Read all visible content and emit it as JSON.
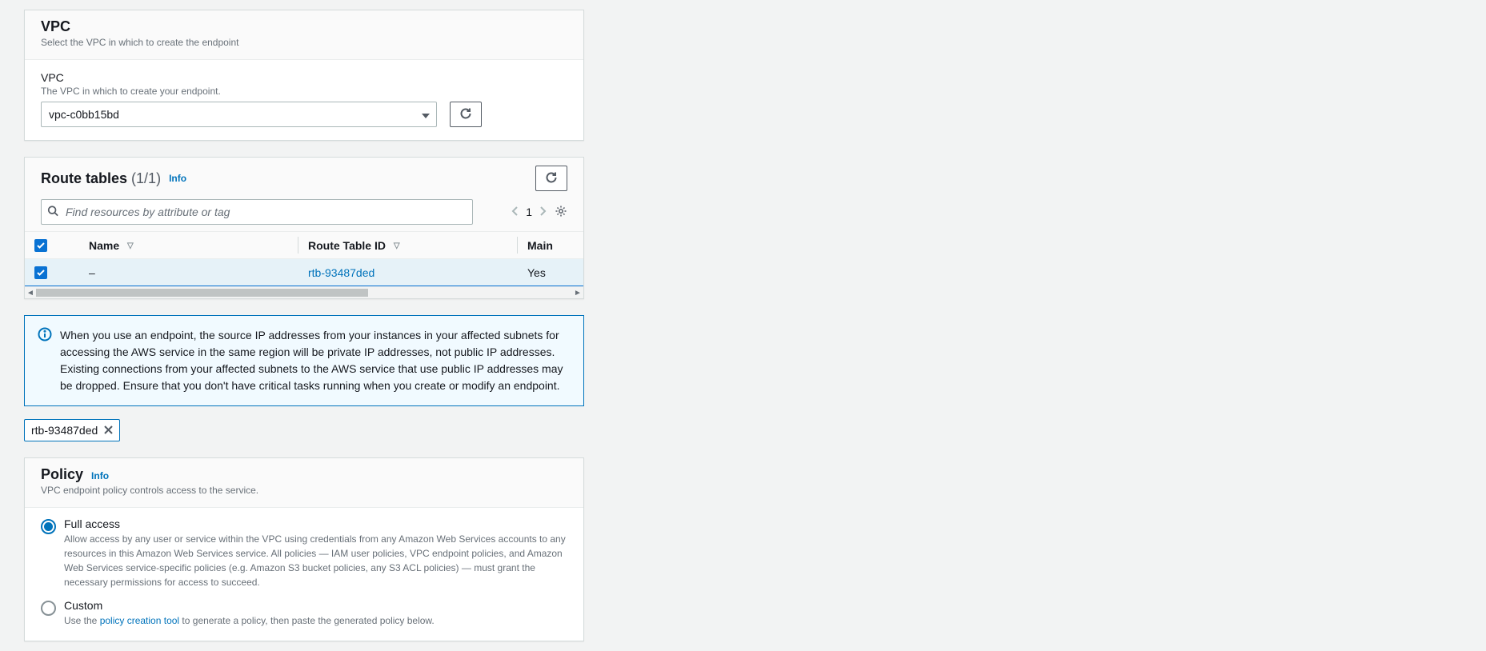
{
  "vpcSection": {
    "title": "VPC",
    "subtitle": "Select the VPC in which to create the endpoint",
    "fieldLabel": "VPC",
    "fieldHelp": "The VPC in which to create your endpoint.",
    "selectedValue": "vpc-c0bb15bd"
  },
  "routeSection": {
    "title": "Route tables",
    "count": "(1/1)",
    "infoLabel": "Info",
    "searchPlaceholder": "Find resources by attribute or tag",
    "pageNumber": "1",
    "columns": {
      "name": "Name",
      "routeTableId": "Route Table ID",
      "main": "Main"
    },
    "rows": [
      {
        "name": "–",
        "routeTableId": "rtb-93487ded",
        "main": "Yes",
        "selected": true
      }
    ]
  },
  "infoAlert": {
    "text": "When you use an endpoint, the source IP addresses from your instances in your affected subnets for accessing the AWS service in the same region will be private IP addresses, not public IP addresses. Existing connections from your affected subnets to the AWS service that use public IP addresses may be dropped. Ensure that you don't have critical tasks running when you create or modify an endpoint."
  },
  "selectedChip": {
    "label": "rtb-93487ded"
  },
  "policySection": {
    "title": "Policy",
    "infoLabel": "Info",
    "subtitle": "VPC endpoint policy controls access to the service.",
    "options": {
      "full": {
        "label": "Full access",
        "desc": "Allow access by any user or service within the VPC using credentials from any Amazon Web Services accounts to any resources in this Amazon Web Services service. All policies — IAM user policies, VPC endpoint policies, and Amazon Web Services service-specific policies (e.g. Amazon S3 bucket policies, any S3 ACL policies) — must grant the necessary permissions for access to succeed."
      },
      "custom": {
        "label": "Custom",
        "descPrefix": "Use the ",
        "descLink": "policy creation tool",
        "descSuffix": " to generate a policy, then paste the generated policy below."
      }
    }
  }
}
